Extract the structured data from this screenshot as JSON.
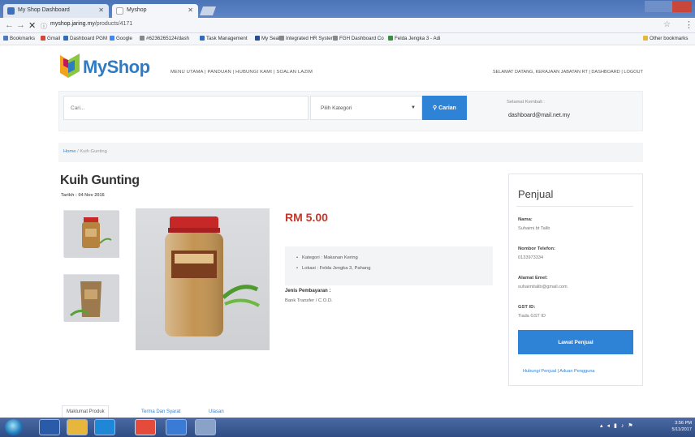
{
  "browser": {
    "tabs": [
      {
        "label": "My Shop Dashboard"
      },
      {
        "label": "Myshop"
      }
    ],
    "url_host": "myshop.jaring.my",
    "url_path": "/products/4171",
    "bookmarks": [
      {
        "label": "Bookmarks",
        "color": "#4a78c2"
      },
      {
        "label": "Gmail",
        "color": "#d44638"
      },
      {
        "label": "Dashboard PGM",
        "color": "#2f6bbf"
      },
      {
        "label": "Google",
        "color": "#4285f4"
      },
      {
        "label": "#6236265124/dash",
        "color": "#888888"
      },
      {
        "label": "Task Management",
        "color": "#2f6bbf"
      },
      {
        "label": "My Seal",
        "color": "#2a4d8f"
      },
      {
        "label": "Integrated HR System",
        "color": "#888888"
      },
      {
        "label": "FGH Dashboard Co",
        "color": "#888888"
      },
      {
        "label": "Felda Jengka 3 - Adi",
        "color": "#3b8e3b"
      },
      {
        "label": "Other bookmarks",
        "color": "#e6b73c"
      }
    ]
  },
  "header": {
    "logo_my": "My",
    "logo_shop": "Shop",
    "nav": "MENU UTAMA | PANDUAN | HUBUNGI KAMI | SOALAN LAZIM",
    "user_nav": "SELAMAT DATANG, KERAJAAN JABATAN RT | DASHBOARD | LOGOUT"
  },
  "search": {
    "placeholder": "Cari...",
    "category_selected": "Pilih Kategori",
    "button_label": "Carian",
    "welcome_label": "Selamat Kembali :",
    "user_email": "dashboard@mail.net.my"
  },
  "breadcrumb": {
    "home": "Home",
    "separator": "/",
    "current": "Kuih Gunting"
  },
  "product": {
    "title": "Kuih Gunting",
    "date": "Tarikh : 04 Nov 2016",
    "price": "RM 5.00",
    "details": [
      "Kategori : Makanan Kering",
      "Lokasi : Felda Jengka 3, Pahang"
    ],
    "payment_label": "Jenis Pembayaran :",
    "payment_value": "Bank Transfer / C.O.D."
  },
  "seller": {
    "title": "Penjual",
    "fields": [
      {
        "label": "Nama:",
        "value": "Suhaimi bt Talib"
      },
      {
        "label": "Nombor Telefon:",
        "value": "0133973334"
      },
      {
        "label": "Alamat Emel:",
        "value": "suhaimitalib@gmail.com"
      },
      {
        "label": "GST ID:",
        "value": "Tiada GST ID"
      }
    ],
    "button_label": "Lawat Penjual",
    "link_label": "Hubungi Penjual | Aduan Pengguna"
  },
  "tabs_bottom": [
    {
      "label": "Maklumat Produk"
    },
    {
      "label": "Terma Dan Syarat"
    },
    {
      "label": "Ulasan"
    }
  ],
  "taskbar": {
    "time": "3:56 PM",
    "date": "5/11/2017",
    "app_colors": [
      "#2a5ba8",
      "#e6b73c",
      "#1e88d6",
      "#e54b3b",
      "#3a7bd5",
      "#8aa2c8"
    ]
  }
}
